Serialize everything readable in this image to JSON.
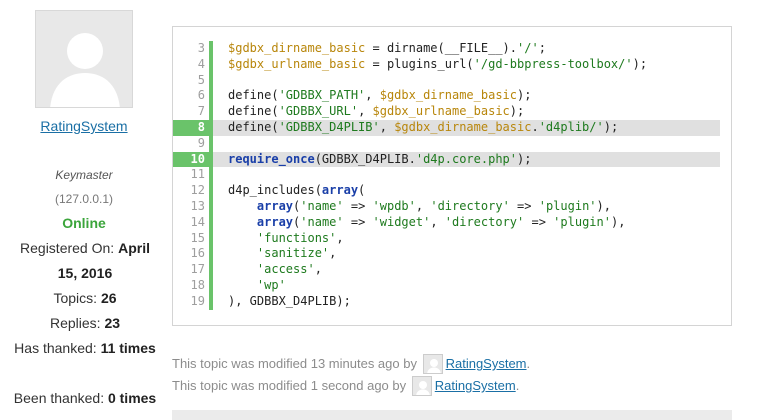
{
  "author": {
    "name": "RatingSystem",
    "role": "Keymaster",
    "ip": "(127.0.0.1)",
    "status": "Online",
    "stats": [
      {
        "label": "Registered On: ",
        "value": "April 15, 2016"
      },
      {
        "label": "Topics: ",
        "value": "26"
      },
      {
        "label": "Replies: ",
        "value": "23"
      },
      {
        "label": "Has thanked: ",
        "value": "11 times"
      },
      {
        "label": "Been thanked: ",
        "value": "0 times"
      }
    ]
  },
  "code": {
    "highlighted_lines": [
      "8",
      "10"
    ],
    "lines": [
      {
        "n": "3",
        "parts": [
          {
            "t": "var",
            "s": "$gdbx_dirname_basic"
          },
          {
            "t": "fn",
            "s": " = dirname(__FILE__)."
          },
          {
            "t": "str",
            "s": "'/'"
          },
          {
            "t": "fn",
            "s": ";"
          }
        ]
      },
      {
        "n": "4",
        "parts": [
          {
            "t": "var",
            "s": "$gdbx_urlname_basic"
          },
          {
            "t": "fn",
            "s": " = plugins_url("
          },
          {
            "t": "str",
            "s": "'/gd-bbpress-toolbox/'"
          },
          {
            "t": "fn",
            "s": ");"
          }
        ]
      },
      {
        "n": "5",
        "parts": []
      },
      {
        "n": "6",
        "parts": [
          {
            "t": "fn",
            "s": "define("
          },
          {
            "t": "str",
            "s": "'GDBBX_PATH'"
          },
          {
            "t": "fn",
            "s": ", "
          },
          {
            "t": "var",
            "s": "$gdbx_dirname_basic"
          },
          {
            "t": "fn",
            "s": ");"
          }
        ]
      },
      {
        "n": "7",
        "parts": [
          {
            "t": "fn",
            "s": "define("
          },
          {
            "t": "str",
            "s": "'GDBBX_URL'"
          },
          {
            "t": "fn",
            "s": ", "
          },
          {
            "t": "var",
            "s": "$gdbx_urlname_basic"
          },
          {
            "t": "fn",
            "s": ");"
          }
        ]
      },
      {
        "n": "8",
        "parts": [
          {
            "t": "fn",
            "s": "define("
          },
          {
            "t": "str",
            "s": "'GDBBX_D4PLIB'"
          },
          {
            "t": "fn",
            "s": ", "
          },
          {
            "t": "var",
            "s": "$gdbx_dirname_basic"
          },
          {
            "t": "fn",
            "s": "."
          },
          {
            "t": "str",
            "s": "'d4plib/'"
          },
          {
            "t": "fn",
            "s": ");"
          }
        ]
      },
      {
        "n": "9",
        "parts": []
      },
      {
        "n": "10",
        "parts": [
          {
            "t": "kw",
            "s": "require_once"
          },
          {
            "t": "fn",
            "s": "(GDBBX_D4PLIB."
          },
          {
            "t": "str",
            "s": "'d4p.core.php'"
          },
          {
            "t": "fn",
            "s": ");"
          }
        ]
      },
      {
        "n": "11",
        "parts": []
      },
      {
        "n": "12",
        "parts": [
          {
            "t": "fn",
            "s": "d4p_includes("
          },
          {
            "t": "kw",
            "s": "array"
          },
          {
            "t": "fn",
            "s": "("
          }
        ]
      },
      {
        "n": "13",
        "parts": [
          {
            "t": "fn",
            "s": "    "
          },
          {
            "t": "kw",
            "s": "array"
          },
          {
            "t": "fn",
            "s": "("
          },
          {
            "t": "str",
            "s": "'name'"
          },
          {
            "t": "fn",
            "s": " => "
          },
          {
            "t": "str",
            "s": "'wpdb'"
          },
          {
            "t": "fn",
            "s": ", "
          },
          {
            "t": "str",
            "s": "'directory'"
          },
          {
            "t": "fn",
            "s": " => "
          },
          {
            "t": "str",
            "s": "'plugin'"
          },
          {
            "t": "fn",
            "s": "),"
          }
        ]
      },
      {
        "n": "14",
        "parts": [
          {
            "t": "fn",
            "s": "    "
          },
          {
            "t": "kw",
            "s": "array"
          },
          {
            "t": "fn",
            "s": "("
          },
          {
            "t": "str",
            "s": "'name'"
          },
          {
            "t": "fn",
            "s": " => "
          },
          {
            "t": "str",
            "s": "'widget'"
          },
          {
            "t": "fn",
            "s": ", "
          },
          {
            "t": "str",
            "s": "'directory'"
          },
          {
            "t": "fn",
            "s": " => "
          },
          {
            "t": "str",
            "s": "'plugin'"
          },
          {
            "t": "fn",
            "s": "),"
          }
        ]
      },
      {
        "n": "15",
        "parts": [
          {
            "t": "fn",
            "s": "    "
          },
          {
            "t": "str",
            "s": "'functions'"
          },
          {
            "t": "fn",
            "s": ","
          }
        ]
      },
      {
        "n": "16",
        "parts": [
          {
            "t": "fn",
            "s": "    "
          },
          {
            "t": "str",
            "s": "'sanitize'"
          },
          {
            "t": "fn",
            "s": ","
          }
        ]
      },
      {
        "n": "17",
        "parts": [
          {
            "t": "fn",
            "s": "    "
          },
          {
            "t": "str",
            "s": "'access'"
          },
          {
            "t": "fn",
            "s": ","
          }
        ]
      },
      {
        "n": "18",
        "parts": [
          {
            "t": "fn",
            "s": "    "
          },
          {
            "t": "str",
            "s": "'wp'"
          }
        ]
      },
      {
        "n": "19",
        "parts": [
          {
            "t": "fn",
            "s": "), GDBBX_D4PLIB);"
          }
        ]
      }
    ]
  },
  "notes": [
    {
      "prefix": "This topic was modified 13 minutes ago by",
      "user": "RatingSystem",
      "suffix": "."
    },
    {
      "prefix": "This topic was modified 1 second ago by",
      "user": "RatingSystem",
      "suffix": "."
    }
  ],
  "colors": {
    "link": "#1a6fa5",
    "online": "#3ba53b",
    "highlight_gutter": "#6ac36a",
    "variable": "#b8860b",
    "string": "#1e7a1e",
    "keyword": "#1a3fa8"
  }
}
